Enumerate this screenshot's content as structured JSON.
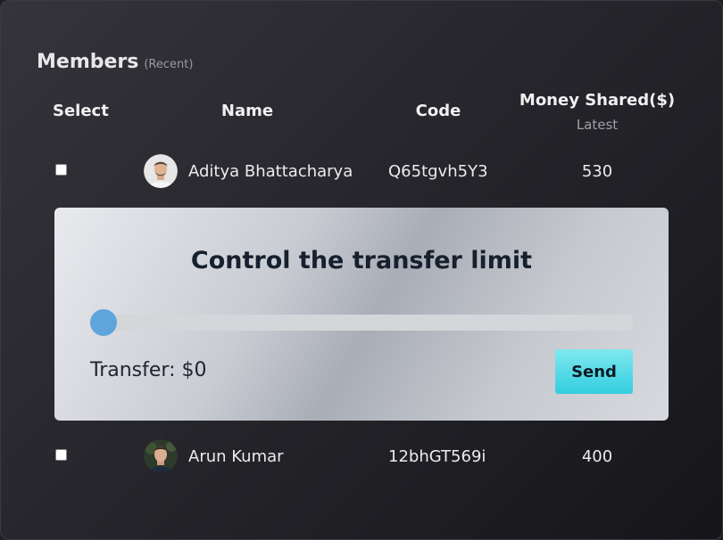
{
  "header": {
    "title": "Members",
    "subtitle": "(Recent)"
  },
  "columns": {
    "select": "Select",
    "name": "Name",
    "code": "Code",
    "money": "Money Shared($)",
    "money_sub": "Latest"
  },
  "members": [
    {
      "name": "Aditya Bhattacharya",
      "code": "Q65tgvh5Y3",
      "amount": "530",
      "checked": false
    },
    {
      "name": "Arun Kumar",
      "code": "12bhGT569i",
      "amount": "400",
      "checked": false
    }
  ],
  "transfer_panel": {
    "title": "Control the transfer limit",
    "slider_value": 0,
    "transfer_label": "Transfer: $0",
    "send_label": "Send"
  },
  "colors": {
    "slider_thumb": "#5ea5dc",
    "send_button": "#33cde0",
    "panel_title": "#16202e"
  }
}
